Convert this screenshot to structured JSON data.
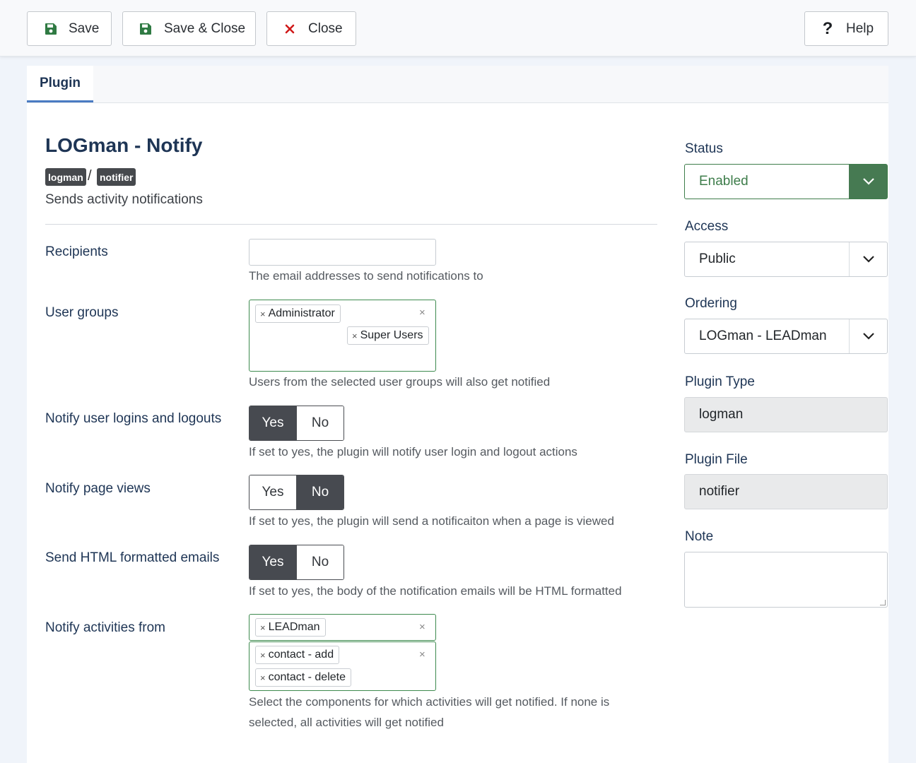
{
  "toolbar": {
    "save_label": "Save",
    "save_close_label": "Save & Close",
    "close_label": "Close",
    "help_label": "Help"
  },
  "tabs": [
    {
      "label": "Plugin",
      "active": true
    }
  ],
  "plugin": {
    "title": "LOGman - Notify",
    "badges": [
      "logman",
      "notifier"
    ],
    "badge_separator": "/",
    "description": "Sends activity notifications"
  },
  "fields": {
    "recipients": {
      "label": "Recipients",
      "value": "",
      "hint": "The email addresses to send notifications to"
    },
    "user_groups": {
      "label": "User groups",
      "selected": [
        "Administrator",
        "Super Users"
      ],
      "hint": "Users from the selected user groups will also get notified"
    },
    "notify_logins": {
      "label": "Notify user logins and logouts",
      "options": [
        "Yes",
        "No"
      ],
      "selected": "Yes",
      "hint": "If set to yes, the plugin will notify user login and logout actions"
    },
    "notify_page_views": {
      "label": "Notify page views",
      "options": [
        "Yes",
        "No"
      ],
      "selected": "No",
      "hint": "If set to yes, the plugin will send a notificaiton when a page is viewed"
    },
    "html_emails": {
      "label": "Send HTML formatted emails",
      "options": [
        "Yes",
        "No"
      ],
      "selected": "Yes",
      "hint": "If set to yes, the body of the notification emails will be HTML formatted"
    },
    "notify_activities": {
      "label": "Notify activities from",
      "components": [
        "LEADman"
      ],
      "actions": [
        "contact - add",
        "contact - delete"
      ],
      "hint_line1": "Select the components for which activities will get notified. If none is",
      "hint_line2": "selected, all activities will get notified"
    }
  },
  "sidebar": {
    "status": {
      "label": "Status",
      "value": "Enabled"
    },
    "access": {
      "label": "Access",
      "value": "Public"
    },
    "ordering": {
      "label": "Ordering",
      "value": "LOGman - LEADman"
    },
    "plugin_type": {
      "label": "Plugin Type",
      "value": "logman"
    },
    "plugin_file": {
      "label": "Plugin File",
      "value": "notifier"
    },
    "note": {
      "label": "Note",
      "value": ""
    }
  },
  "colors": {
    "accent_green": "#467a52",
    "heading_blue": "#1e3555",
    "close_red": "#d01a1a",
    "toggle_active": "#474a50",
    "tab_underline": "#4a7bc2"
  },
  "icons": {
    "save": "floppy-disk-icon",
    "save_close": "floppy-disk-icon",
    "close": "close-x-icon",
    "help": "question-mark-icon",
    "dropdown": "chevron-down-icon"
  }
}
